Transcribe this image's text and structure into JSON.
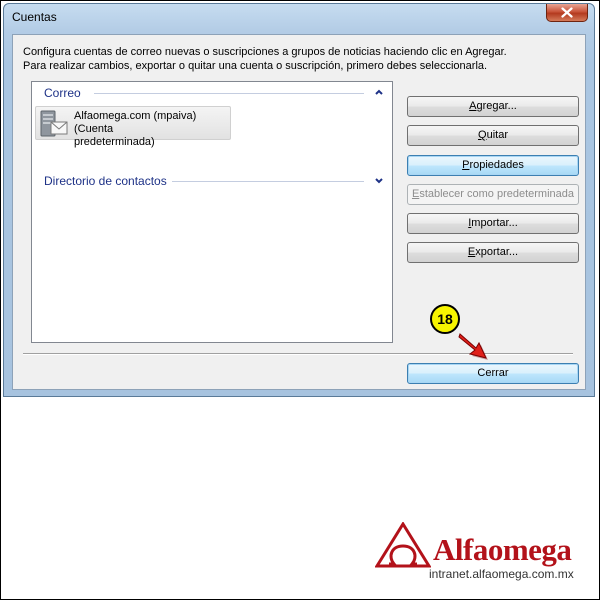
{
  "window": {
    "title": "Cuentas",
    "description_line1": "Configura cuentas de correo nuevas o suscripciones a grupos de noticias haciendo clic en Agregar.",
    "description_line2": "Para realizar cambios, exportar o quitar una cuenta o suscripción, primero debes seleccionarla."
  },
  "list": {
    "groups": [
      {
        "label": "Correo",
        "state": "expanded"
      },
      {
        "label": "Directorio de contactos",
        "state": "collapsed"
      }
    ],
    "account": {
      "line1": "Alfaomega.com (mpaiva) (Cuenta",
      "line2": "predeterminada)"
    }
  },
  "buttons": {
    "agregar": {
      "pre": "",
      "key": "A",
      "post": "gregar..."
    },
    "quitar": {
      "pre": "",
      "key": "Q",
      "post": "uitar"
    },
    "propiedades": {
      "pre": "",
      "key": "P",
      "post": "ropiedades"
    },
    "establecer": {
      "pre": "",
      "key": "E",
      "post": "stablecer como predeterminada"
    },
    "importar": {
      "pre": "",
      "key": "I",
      "post": "mportar..."
    },
    "exportar": {
      "pre": "",
      "key": "E",
      "post": "xportar..."
    },
    "cerrar": {
      "label": "Cerrar"
    }
  },
  "annotation": {
    "step": "18"
  },
  "branding": {
    "name": "Alfaomega",
    "url": "intranet.alfaomega.com.mx"
  },
  "colors": {
    "group_header": "#1e3287",
    "brand_red": "#b3121a",
    "callout_yellow": "#f7f400",
    "arrow_red": "#e0201a"
  },
  "icons": {
    "close": "close-icon",
    "account": "mail-server-icon",
    "collapse": "chevron-up-icon",
    "expand": "chevron-down-icon",
    "pointer": "arrow-pointer-icon",
    "logo": "alfaomega-logo-icon"
  }
}
